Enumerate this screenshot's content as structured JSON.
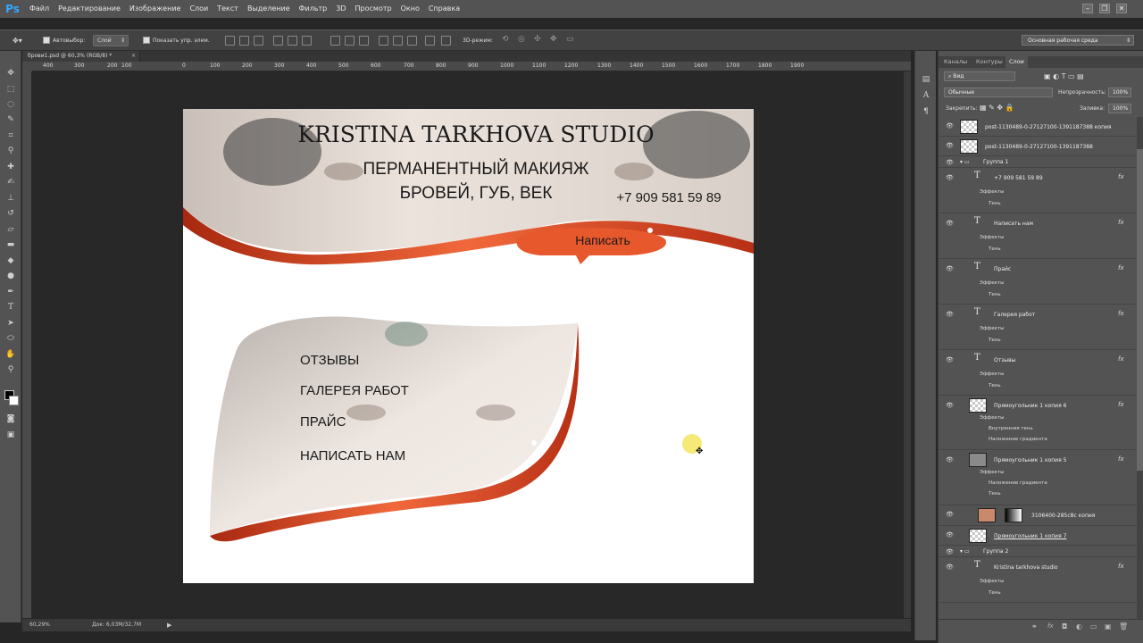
{
  "app": {
    "logo": "Ps"
  },
  "menu": [
    "Файл",
    "Редактирование",
    "Изображение",
    "Слои",
    "Текст",
    "Выделение",
    "Фильтр",
    "3D",
    "Просмотр",
    "Окно",
    "Справка"
  ],
  "window_controls": [
    "–",
    "❐",
    "✕"
  ],
  "options": {
    "autoselect_label": "Автовыбор:",
    "autoselect_value": "Слой",
    "show_controls_label": "Показать упр. элем.",
    "mode3d_label": "3D-режим:",
    "workspace": "Основная рабочая среда"
  },
  "document": {
    "tab_title": "брови1.psd @ 60,3% (RGB/8) *",
    "zoom": "60,29%",
    "doc_size": "Док: 6,03M/32,7M",
    "ruler_ticks": [
      "400",
      "300",
      "200",
      "100",
      "0",
      "100",
      "200",
      "300",
      "400",
      "500",
      "600",
      "700",
      "800",
      "900",
      "1000",
      "1100",
      "1200",
      "1300",
      "1400",
      "1500",
      "1600",
      "1700",
      "1800",
      "1900"
    ]
  },
  "design": {
    "studio_title": "KRISTINA TARKHOVA STUDIO",
    "headline_1": "ПЕРМАНЕНТНЫЙ МАКИЯЖ",
    "headline_2": "БРОВЕЙ, ГУБ, ВЕК",
    "phone": "+7 909 581 59 89",
    "cta": "Написать",
    "menu_items": [
      "ОТЗЫВЫ",
      "ГАЛЕРЕЯ РАБОТ",
      "ПРАЙС",
      "НАПИСАТЬ НАМ"
    ]
  },
  "panel": {
    "tabs": [
      "Каналы",
      "Контуры",
      "Слои"
    ],
    "active_tab": "Слои",
    "filter": "Вид",
    "blend_mode": "Обычные",
    "opacity_label": "Непрозрачность:",
    "opacity_value": "100%",
    "lock_label": "Закрепить:",
    "fill_label": "Заливка:",
    "fill_value": "100%",
    "layers": [
      {
        "name": "post-1130489-0-27127100-1391187388 копия",
        "kind": "image"
      },
      {
        "name": "post-1130489-0-27127100-1391187388",
        "kind": "image"
      },
      {
        "name": "Группа 1",
        "kind": "group"
      },
      {
        "name": "+7 909 581 59 89",
        "kind": "text",
        "effects": [
          "Эффекты",
          "Тень"
        ]
      },
      {
        "name": "Написать нам",
        "kind": "text",
        "effects": [
          "Эффекты",
          "Тень"
        ]
      },
      {
        "name": "Прайс",
        "kind": "text",
        "effects": [
          "Эффекты",
          "Тень"
        ]
      },
      {
        "name": "Галерея работ",
        "kind": "text",
        "effects": [
          "Эффекты",
          "Тень"
        ]
      },
      {
        "name": "Отзывы",
        "kind": "text",
        "effects": [
          "Эффекты",
          "Тень"
        ]
      },
      {
        "name": "Прямоугольник 1 копия 6",
        "kind": "shape",
        "effects": [
          "Эффекты",
          "Внутренняя тень",
          "Наложение градиента"
        ]
      },
      {
        "name": "Прямоугольник 1 копия 5",
        "kind": "shape",
        "effects": [
          "Эффекты",
          "Наложение градиента",
          "Тень"
        ]
      },
      {
        "name": "3106400-285c8c копия",
        "kind": "masked"
      },
      {
        "name": "Прямоугольник 1 копия 7",
        "kind": "shape"
      },
      {
        "name": "Группа 2",
        "kind": "group"
      },
      {
        "name": "Kristina tarkhova studio",
        "kind": "text",
        "effects": [
          "Эффекты",
          "Тень"
        ]
      }
    ]
  }
}
